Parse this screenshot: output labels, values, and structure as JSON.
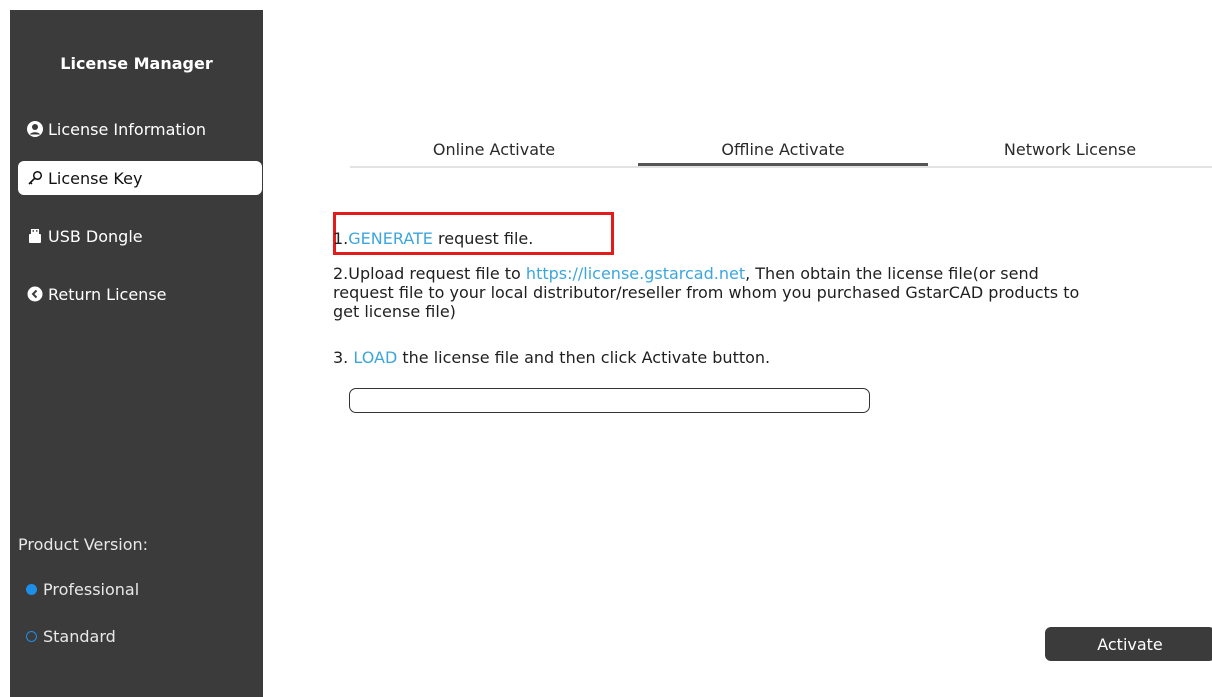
{
  "sidebar": {
    "title": "License Manager",
    "items": [
      {
        "label": "License Information",
        "icon": "user-circle-icon"
      },
      {
        "label": "License Key",
        "icon": "key-icon",
        "active": true
      },
      {
        "label": "USB Dongle",
        "icon": "usb-icon"
      },
      {
        "label": "Return License",
        "icon": "return-icon"
      }
    ],
    "product_version_label": "Product Version:",
    "versions": [
      {
        "label": "Professional",
        "selected": true
      },
      {
        "label": "Standard",
        "selected": false
      }
    ]
  },
  "tabs": [
    {
      "label": "Online Activate"
    },
    {
      "label": "Offline Activate",
      "active": true
    },
    {
      "label": "Network License"
    }
  ],
  "steps": {
    "step1": {
      "prefix": "1.",
      "link": "GENERATE",
      "suffix": " request file."
    },
    "step2": {
      "prefix": "2.Upload request file to ",
      "link": "https://license.gstarcad.net",
      "line1_suffix": ", Then obtain the license file(or send",
      "line2": "request file to your local distributor/reseller from whom you purchased GstarCAD products to",
      "line3": "get license file)"
    },
    "step3": {
      "prefix": "3. ",
      "link": "LOAD",
      "suffix": " the license file and then click Activate button."
    }
  },
  "license_file_input": {
    "value": "",
    "placeholder": ""
  },
  "activate_button": {
    "label": "Activate"
  },
  "colors": {
    "sidebar_bg": "#3b3b3b",
    "link": "#3ca6dc",
    "radio": "#1e8fe9",
    "highlight": "#e31b1b"
  }
}
